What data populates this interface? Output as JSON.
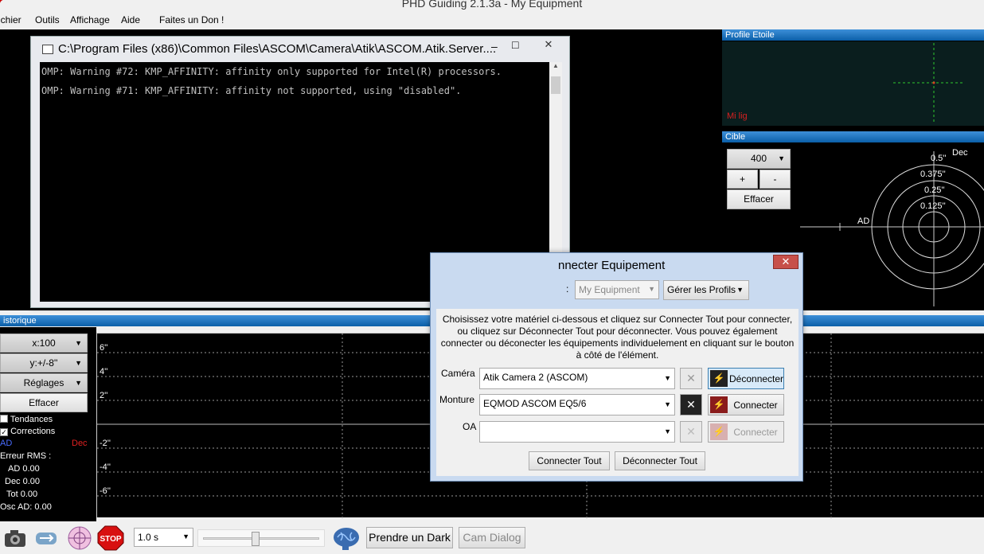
{
  "app": {
    "title": "PHD Guiding 2.1.3a - My Equipment"
  },
  "menu": [
    "ichier",
    "Outils",
    "Affichage",
    "Aide",
    "Faites un Don !"
  ],
  "profile": {
    "header": "Profile Etoile",
    "label": "Mi lig"
  },
  "cible": {
    "header": "Cible",
    "scale_value": "400",
    "plus": "+",
    "minus": "-",
    "clear": "Effacer",
    "ring_labels": [
      "0.5''",
      "0.375''",
      "0.25''",
      "0.125''"
    ],
    "axis_dec": "Dec",
    "axis_ad": "AD"
  },
  "history": {
    "header": "istorique",
    "x_scale": "x:100",
    "y_scale": "y:+/-8''",
    "settings": "Réglages",
    "clear": "Effacer",
    "trends_label": "Tendances",
    "trends_checked": false,
    "corrections_label": "Corrections",
    "corrections_checked": true,
    "ad_label": "AD",
    "dec_label": "Dec",
    "rms_title": "Erreur RMS :",
    "rms_ad": "AD 0.00",
    "rms_dec": "Dec 0.00",
    "rms_tot": "Tot 0.00",
    "osc_ad": "Osc AD: 0.00",
    "y_ticks": [
      "6''",
      "4''",
      "2''",
      "-2''",
      "-4''",
      "-6''"
    ]
  },
  "console": {
    "title": "C:\\Program Files (x86)\\Common Files\\ASCOM\\Camera\\Atik\\ASCOM.Atik.Server....",
    "lines": [
      "OMP: Warning #72: KMP_AFFINITY: affinity only supported for Intel(R) processors.",
      "OMP: Warning #71: KMP_AFFINITY: affinity not supported, using \"disabled\"."
    ],
    "min": "–",
    "max": "□",
    "close": "✕"
  },
  "dialog": {
    "title": "nnecter Equipement",
    "close": "✕",
    "profile_prefix": ":",
    "profile_value": "My Equipment",
    "manage_profiles": "Gérer les Profils",
    "instructions": "Choisissez votre matériel ci-dessous et cliquez sur Connecter Tout pour connecter, ou cliquez sur Déconnecter Tout pour déconnecter. Vous pouvez également connecter ou déconecter les équipements individuelement en cliquant sur le bouton à côté de l'élément.",
    "rows": [
      {
        "label": "Caméra",
        "value": "Atik Camera 2 (ASCOM)",
        "button": "Déconnecter",
        "state": "connected"
      },
      {
        "label": "Monture",
        "value": "EQMOD ASCOM EQ5/6",
        "button": "Connecter",
        "state": "disconnected"
      },
      {
        "label": "OA",
        "value": "",
        "button": "Connecter",
        "state": "disabled"
      }
    ],
    "connect_all": "Connecter Tout",
    "disconnect_all": "Déconnecter Tout"
  },
  "toolbar": {
    "exposure": "1.0 s",
    "dark_button": "Prendre un Dark",
    "cam_dialog": "Cam Dialog",
    "stop": "STOP"
  }
}
